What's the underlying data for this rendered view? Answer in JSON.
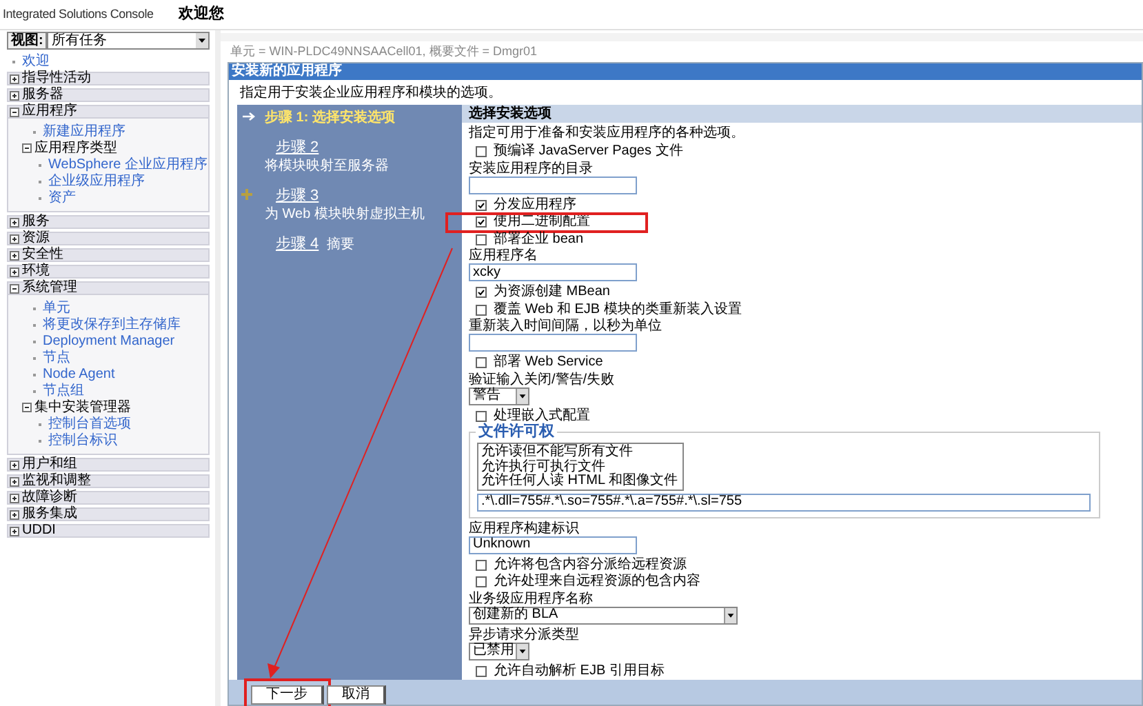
{
  "header": {
    "product": "Integrated Solutions Console",
    "welcome": "欢迎您"
  },
  "nav": {
    "view_label": "视图:",
    "view_value": "所有任务",
    "items": [
      {
        "kind": "link",
        "label": "欢迎"
      },
      {
        "kind": "group",
        "label": "指导性活动",
        "expanded": false
      },
      {
        "kind": "group",
        "label": "服务器",
        "expanded": false
      },
      {
        "kind": "group",
        "label": "应用程序",
        "expanded": true,
        "children": [
          {
            "kind": "link",
            "label": "新建应用程序"
          },
          {
            "kind": "subgroup",
            "label": "应用程序类型",
            "expanded": true,
            "children": [
              {
                "kind": "link",
                "label": "WebSphere 企业应用程序"
              },
              {
                "kind": "link",
                "label": "企业级应用程序"
              },
              {
                "kind": "link",
                "label": "资产"
              }
            ]
          }
        ]
      },
      {
        "kind": "group",
        "label": "服务",
        "expanded": false
      },
      {
        "kind": "group",
        "label": "资源",
        "expanded": false
      },
      {
        "kind": "group",
        "label": "安全性",
        "expanded": false
      },
      {
        "kind": "group",
        "label": "环境",
        "expanded": false
      },
      {
        "kind": "group",
        "label": "系统管理",
        "expanded": true,
        "children": [
          {
            "kind": "link",
            "label": "单元"
          },
          {
            "kind": "link",
            "label": "将更改保存到主存储库"
          },
          {
            "kind": "link",
            "label": "Deployment Manager"
          },
          {
            "kind": "link",
            "label": "节点"
          },
          {
            "kind": "link",
            "label": "Node Agent"
          },
          {
            "kind": "link",
            "label": "节点组"
          },
          {
            "kind": "subgroup",
            "label": "集中安装管理器",
            "expanded": true,
            "children": [
              {
                "kind": "link",
                "label": "控制台首选项"
              },
              {
                "kind": "link",
                "label": "控制台标识"
              }
            ]
          }
        ]
      },
      {
        "kind": "group",
        "label": "用户和组",
        "expanded": false
      },
      {
        "kind": "group",
        "label": "监视和调整",
        "expanded": false
      },
      {
        "kind": "group",
        "label": "故障诊断",
        "expanded": false
      },
      {
        "kind": "group",
        "label": "服务集成",
        "expanded": false
      },
      {
        "kind": "group",
        "label": "UDDI",
        "expanded": false
      }
    ]
  },
  "breadcrumb": "单元 = WIN-PLDC49NNSAACell01, 概要文件 = Dmgr01",
  "panel": {
    "title": "安装新的应用程序",
    "intro": "指定用于安装企业应用程序和模块的选项。",
    "steps": [
      {
        "link": "步骤 1: 选择安装选项",
        "current": true,
        "marked": false
      },
      {
        "link": "步骤 2",
        "text": "将模块映射至服务器",
        "current": false,
        "marked": false
      },
      {
        "link": "步骤 3",
        "text": "为 Web 模块映射虚拟主机",
        "current": false,
        "marked": true
      },
      {
        "link": "步骤 4",
        "text": "摘要",
        "current": false,
        "marked": false
      }
    ],
    "form": {
      "title": "选择安装选项",
      "description": "指定可用于准备和安装应用程序的各种选项。",
      "options": [
        {
          "kind": "checkbox",
          "label": "预编译 JavaServer Pages 文件",
          "checked": false,
          "highlighted": false
        },
        {
          "kind": "text",
          "label": "安装应用程序的目录"
        },
        {
          "kind": "checkbox",
          "label": "分发应用程序",
          "checked": true,
          "highlighted": false
        },
        {
          "kind": "checkbox",
          "label": "使用二进制配置",
          "checked": true,
          "highlighted": true
        },
        {
          "kind": "checkbox",
          "label": "部署企业 bean",
          "checked": false,
          "highlighted": false
        },
        {
          "kind": "text",
          "label": "应用程序名",
          "value": "xcky"
        },
        {
          "kind": "checkbox",
          "label": "为资源创建 MBean",
          "checked": true,
          "highlighted": false
        },
        {
          "kind": "checkbox",
          "label": "覆盖 Web 和 EJB 模块的类重新装入设置",
          "checked": false,
          "highlighted": false
        },
        {
          "kind": "text",
          "label": "重新装入时间间隔，以秒为单位"
        },
        {
          "kind": "checkbox",
          "label": "部署 Web Service",
          "checked": false,
          "highlighted": false
        },
        {
          "kind": "select",
          "label": "验证输入关闭/警告/失败",
          "value": "警告"
        },
        {
          "kind": "checkbox",
          "label": "处理嵌入式配置",
          "checked": false,
          "highlighted": false
        },
        {
          "kind": "permissions",
          "legend": "文件许可权",
          "choices": [
            "允许读但不能写所有文件",
            "允许执行可执行文件",
            "允许任何人读 HTML 和图像文件"
          ],
          "value": ".*\\.dll=755#.*\\.so=755#.*\\.a=755#.*\\.sl=755"
        },
        {
          "kind": "text",
          "label": "应用程序构建标识",
          "value": "Unknown"
        },
        {
          "kind": "checkbox",
          "label": "允许将包含内容分派给远程资源",
          "checked": false,
          "highlighted": false
        },
        {
          "kind": "checkbox",
          "label": "允许处理来自远程资源的包含内容",
          "checked": false,
          "highlighted": false
        },
        {
          "kind": "wideselect",
          "label": "业务级应用程序名称",
          "value": "创建新的 BLA"
        },
        {
          "kind": "select",
          "label": "异步请求分派类型",
          "value": "已禁用"
        },
        {
          "kind": "checkbox",
          "label": "允许自动解析 EJB 引用目标",
          "checked": false,
          "highlighted": false
        }
      ]
    },
    "buttons": [
      {
        "label": "下一步",
        "highlighted": true
      },
      {
        "label": "取消",
        "highlighted": false
      }
    ]
  }
}
